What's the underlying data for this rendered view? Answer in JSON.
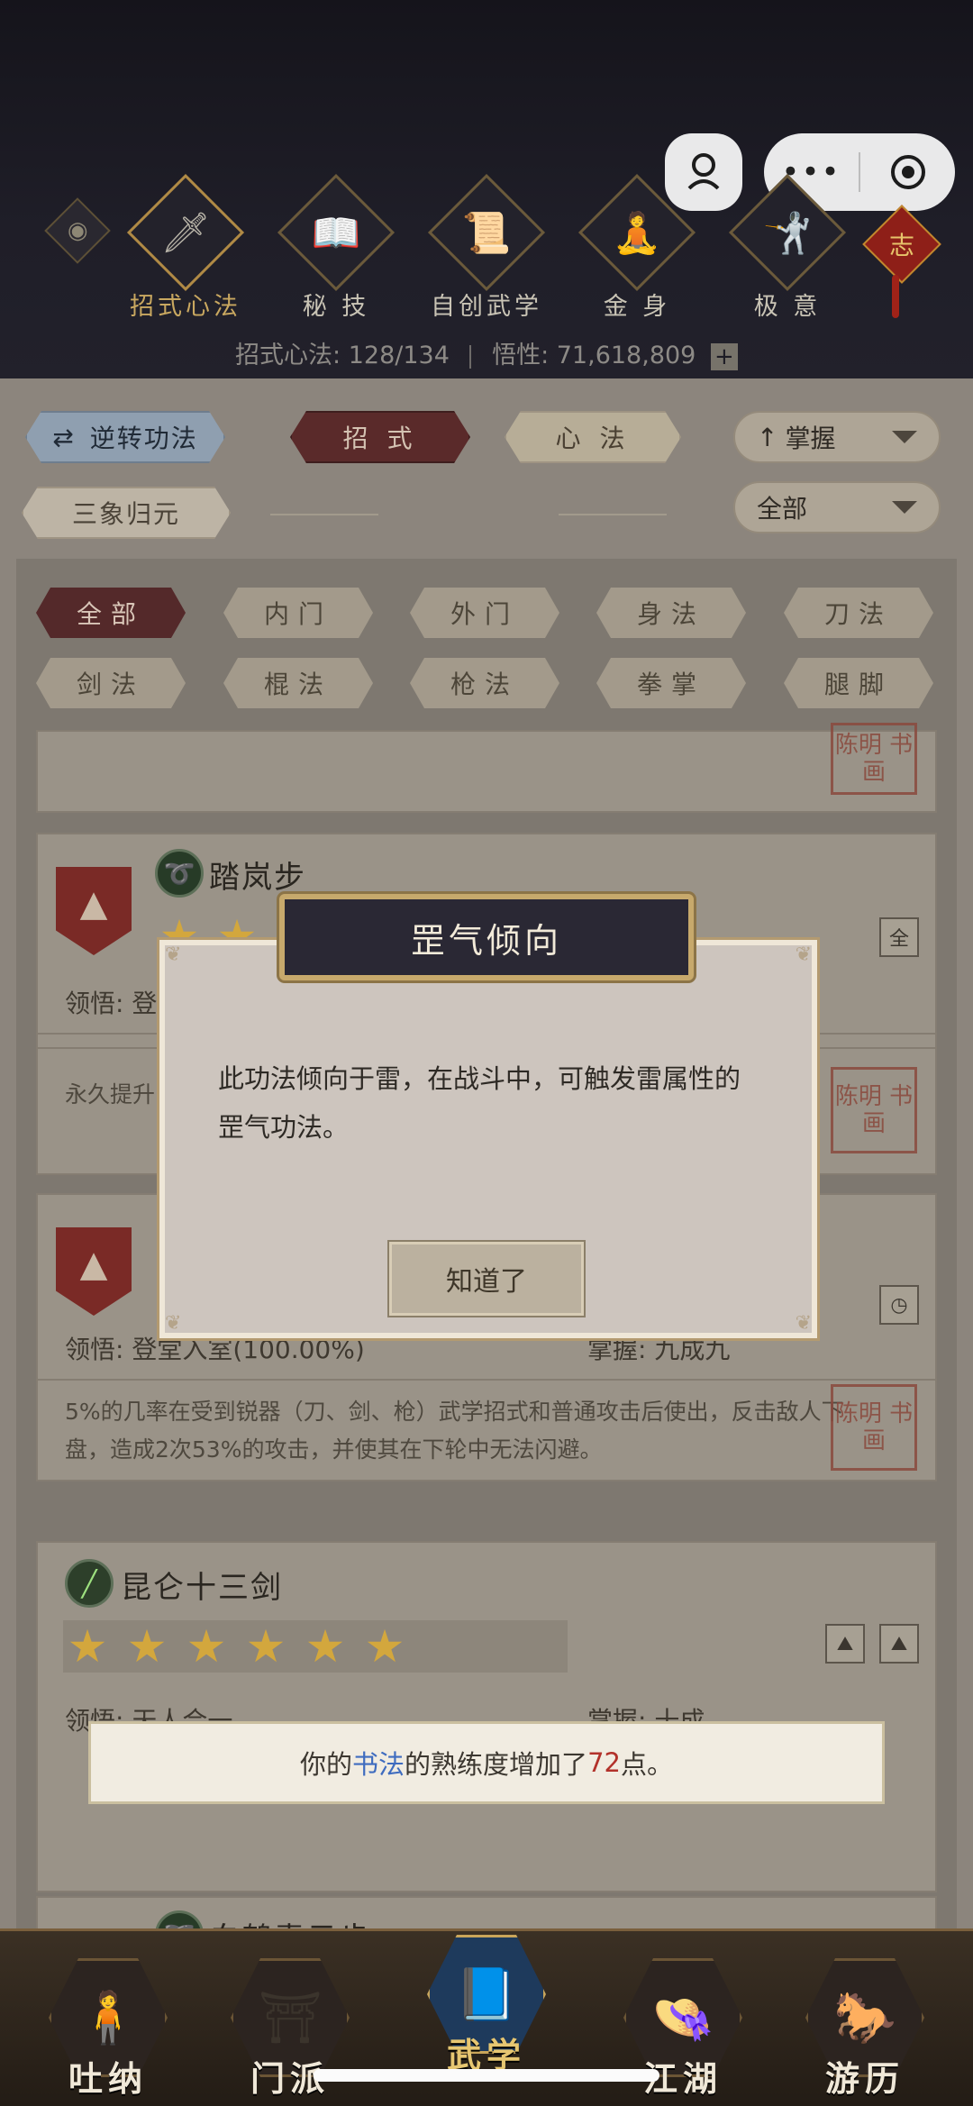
{
  "header": {
    "tabs": [
      {
        "label": "招式心法",
        "icon": "sword-icon",
        "glyph": "🗡"
      },
      {
        "label": "秘 技",
        "icon": "book-icon",
        "glyph": "📖"
      },
      {
        "label": "自创武学",
        "icon": "scroll-icon",
        "glyph": "📜"
      },
      {
        "label": "金 身",
        "icon": "meditation-icon",
        "glyph": "🧘"
      },
      {
        "label": "极 意",
        "icon": "martial-pose-icon",
        "glyph": "🤺"
      }
    ],
    "zhi_label": "志",
    "stats": {
      "moves_label": "招式心法: 128/134",
      "insight_label": "悟性: 71,618,809",
      "plus": "+"
    }
  },
  "controls": {
    "reverse_label": "逆转功法",
    "move_tab": "招 式",
    "heart_tab": "心 法",
    "sort_select": "掌握",
    "preset_label": "三象归元",
    "scope_select": "全部"
  },
  "filters": [
    "全部",
    "内门",
    "外门",
    "身法",
    "刀法",
    "剑法",
    "棍法",
    "枪法",
    "拳掌",
    "腿脚"
  ],
  "cards": [
    {
      "name": "踏岚步",
      "stars": 2,
      "insight_label": "领悟:",
      "insight_value": "登",
      "desc": "永久提升",
      "tag": "全"
    },
    {
      "name": "",
      "insight_label": "领悟:",
      "insight_value": "登堂入室(100.00%)",
      "mastery_label": "掌握:",
      "mastery_value": "九成九",
      "desc": "5%的几率在受到锐器（刀、剑、枪）武学招式和普通攻击后使出，反击敌人下盘，造成2次53%的攻击，并使其在下轮中无法闪避。"
    },
    {
      "name": "昆仑十三剑",
      "stars": 6,
      "insight_label": "领悟:",
      "insight_value": "天人合一",
      "mastery_label": "掌握:",
      "mastery_value": "十成"
    },
    {
      "name": "白鹤青云步"
    }
  ],
  "seal_text": "陈明 书画",
  "dialog": {
    "title": "罡气倾向",
    "body": "此功法倾向于雷，在战斗中，可触发雷属性的罡气功法。",
    "button": "知道了"
  },
  "toast": {
    "prefix": "你的",
    "skill": "书法",
    "middle": "的熟练度增加了",
    "amount": "72",
    "suffix": "点。"
  },
  "bottom_nav": [
    {
      "label": "吐纳",
      "icon": "meditating-figure-icon",
      "glyph": "🧍"
    },
    {
      "label": "门派",
      "icon": "sect-emblem-icon",
      "glyph": "⛩"
    },
    {
      "label": "武学",
      "icon": "manual-books-icon",
      "glyph": "📘"
    },
    {
      "label": "江湖",
      "icon": "bamboo-hat-icon",
      "glyph": "👒"
    },
    {
      "label": "游历",
      "icon": "white-horse-icon",
      "glyph": "🐎"
    }
  ]
}
